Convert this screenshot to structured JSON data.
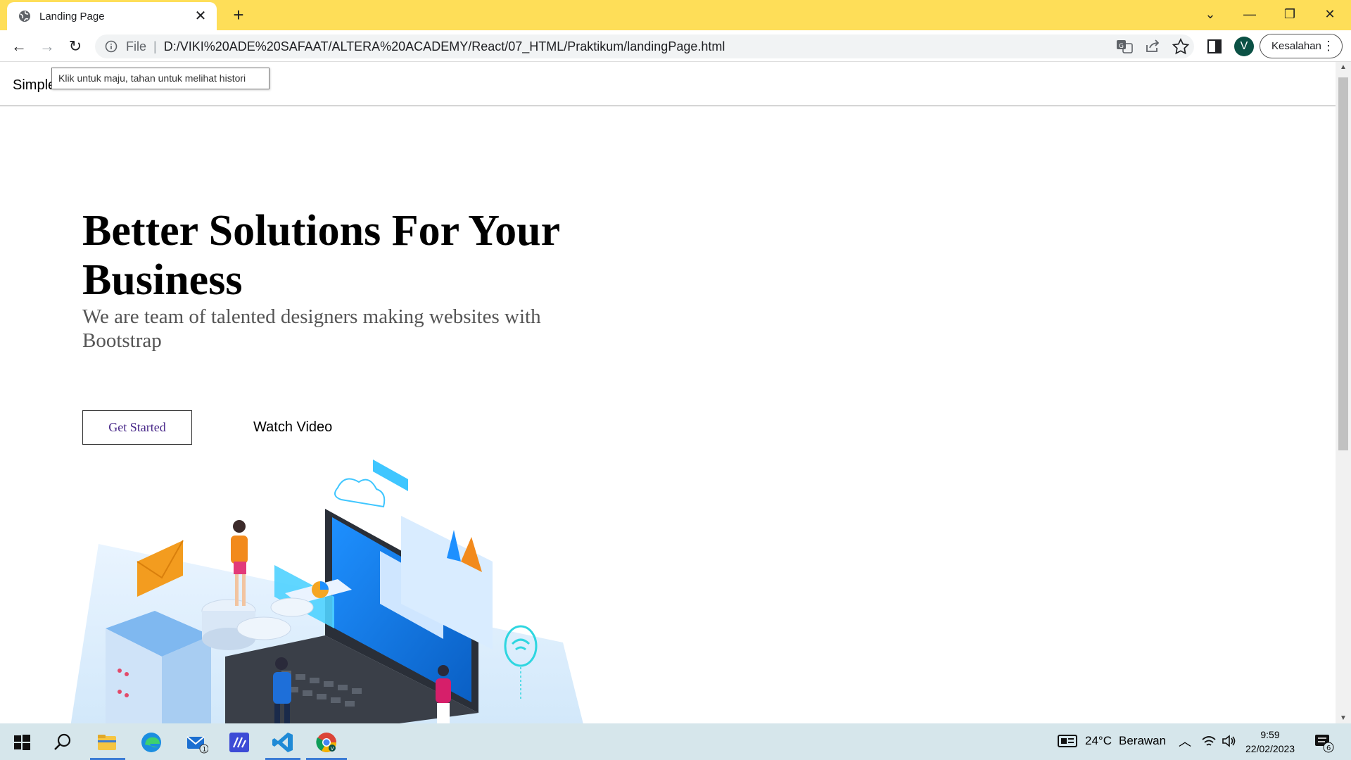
{
  "browser": {
    "tab_title": "Landing Page",
    "new_tab": "+",
    "address_scheme": "File",
    "address_url": "D:/VIKI%20ADE%20SAFAAT/ALTERA%20ACADEMY/React/07_HTML/Praktikum/landingPage.html",
    "profile_initial": "V",
    "error_button": "Kesalahan",
    "forward_tooltip": "Klik untuk maju, tahan untuk melihat histori",
    "icons": [
      "back-arrow-icon",
      "forward-arrow-icon",
      "reload-icon",
      "info-icon",
      "translate-icon",
      "share-icon",
      "star-icon",
      "side-panel-icon",
      "kebab-menu-icon"
    ]
  },
  "page": {
    "brand": "Simple",
    "hero_title": "Better Solutions For Your Business",
    "hero_subtitle": "We are team of talented designers making websites with Bootstrap",
    "cta_primary": "Get Started",
    "cta_secondary": "Watch Video"
  },
  "taskbar": {
    "weather_temp": "24°C",
    "weather_desc": "Berawan",
    "time": "9:59",
    "date": "22/02/2023",
    "mail_badge": "1",
    "notification_badge": "6",
    "apps": [
      "windows-start",
      "search",
      "file-explorer",
      "edge",
      "mail",
      "visual-studio",
      "vs-code",
      "chrome"
    ]
  },
  "colors": {
    "tabbar": "#FEDE58",
    "taskbar": "#D6E6EB",
    "profile": "#0B5145",
    "cta_text": "#4a2a8a"
  }
}
